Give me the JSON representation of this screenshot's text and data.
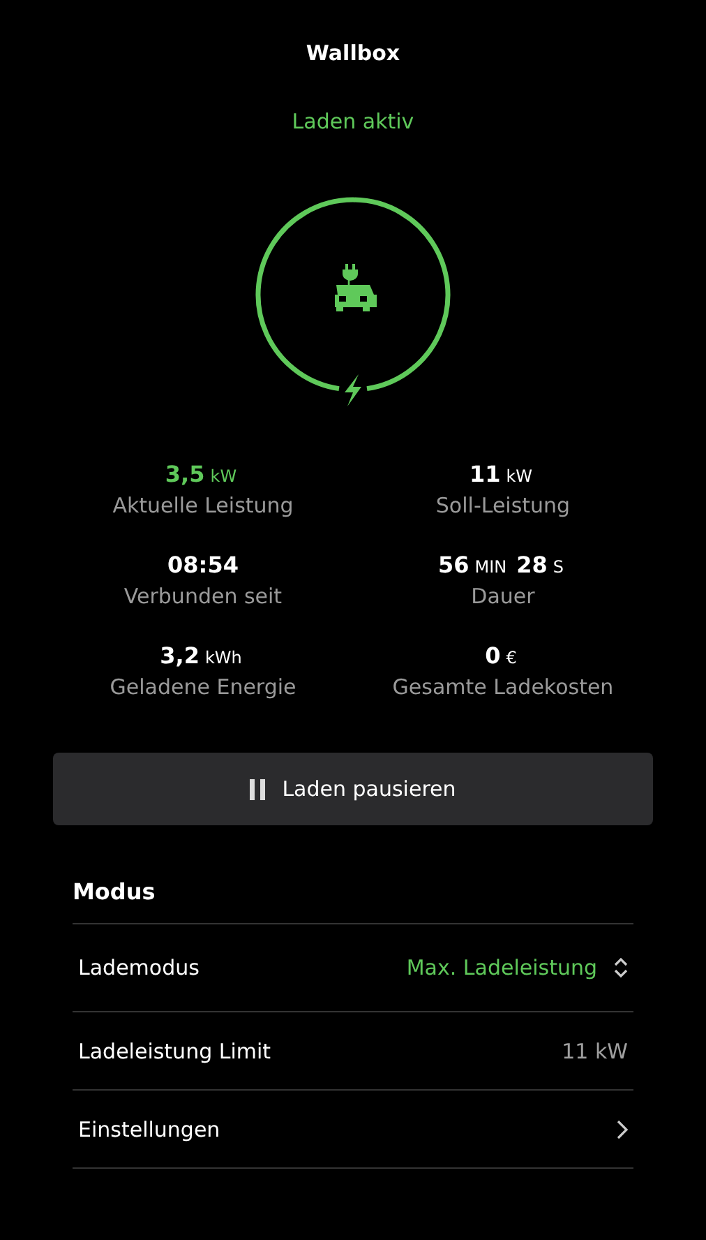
{
  "header": {
    "title": "Wallbox",
    "status": "Laden aktiv"
  },
  "stats": [
    {
      "value": [
        {
          "kind": "number",
          "text": "3,5"
        },
        {
          "kind": "unit",
          "text": "kW"
        }
      ],
      "label": "Aktuelle Leistung",
      "highlight": true
    },
    {
      "value": [
        {
          "kind": "number",
          "text": "11"
        },
        {
          "kind": "unit",
          "text": "kW"
        }
      ],
      "label": "Soll-Leistung",
      "highlight": false
    },
    {
      "value": [
        {
          "kind": "number",
          "text": "08:54"
        }
      ],
      "label": "Verbunden seit",
      "highlight": false
    },
    {
      "value": [
        {
          "kind": "number",
          "text": "56"
        },
        {
          "kind": "unit",
          "text": "MIN"
        },
        {
          "kind": "number",
          "text": "28"
        },
        {
          "kind": "unit",
          "text": "S"
        }
      ],
      "label": "Dauer",
      "highlight": false
    },
    {
      "value": [
        {
          "kind": "number",
          "text": "3,2"
        },
        {
          "kind": "unit",
          "text": "kWh"
        }
      ],
      "label": "Geladene Energie",
      "highlight": false
    },
    {
      "value": [
        {
          "kind": "number",
          "text": "0"
        },
        {
          "kind": "unit",
          "text": "€"
        }
      ],
      "label": "Gesamte Ladekosten",
      "highlight": false
    }
  ],
  "action_button": {
    "label": "Laden pausieren"
  },
  "section": {
    "title": "Modus",
    "rows": [
      {
        "kind": "select",
        "label": "Lademodus",
        "value": "Max. Ladeleistung"
      },
      {
        "kind": "value",
        "label": "Ladeleistung Limit",
        "value": "11 kW"
      },
      {
        "kind": "link",
        "label": "Einstellungen"
      }
    ]
  }
}
